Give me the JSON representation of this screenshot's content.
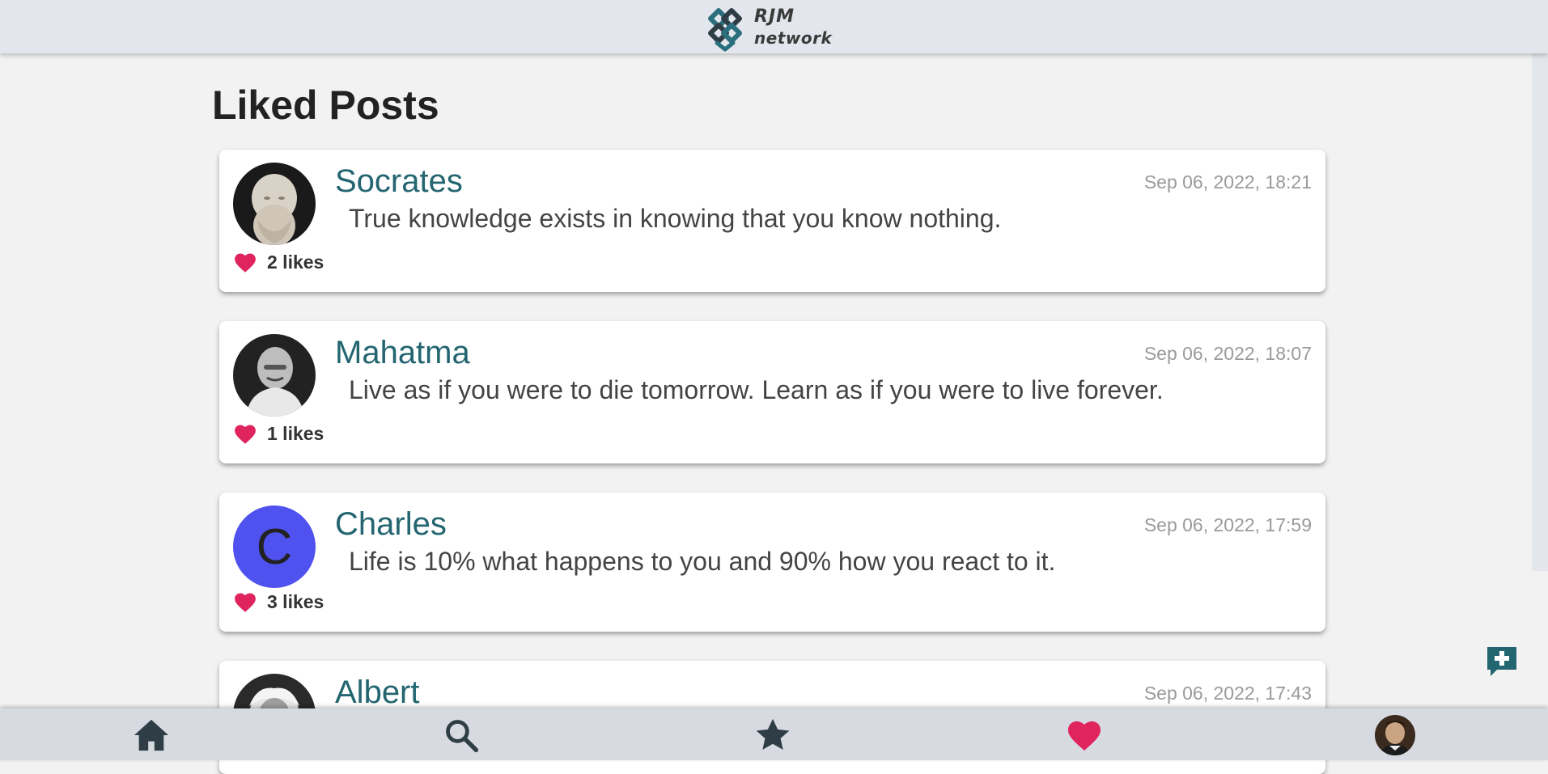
{
  "header": {
    "logo_line1": "RJM",
    "logo_line2": "network"
  },
  "page": {
    "title": "Liked Posts"
  },
  "posts": [
    {
      "author": "Socrates",
      "timestamp": "Sep 06, 2022, 18:21",
      "text": "True knowledge exists in knowing that you know nothing.",
      "likes": "2 likes",
      "avatar": "portrait-photo"
    },
    {
      "author": "Mahatma",
      "timestamp": "Sep 06, 2022, 18:07",
      "text": "Live as if you were to die tomorrow. Learn as if you were to live forever.",
      "likes": "1 likes",
      "avatar": "portrait-photo"
    },
    {
      "author": "Charles",
      "timestamp": "Sep 06, 2022, 17:59",
      "text": "Life is 10% what happens to you and 90% how you react to it.",
      "likes": "3 likes",
      "avatar_letter": "C",
      "avatar_color": "#4f52ee"
    },
    {
      "author": "Albert",
      "timestamp": "Sep 06, 2022, 17:43",
      "avatar": "portrait-photo"
    }
  ],
  "nav": {
    "items": [
      {
        "name": "home",
        "icon": "home-icon",
        "active": false
      },
      {
        "name": "search",
        "icon": "search-icon",
        "active": false
      },
      {
        "name": "starred",
        "icon": "star-icon",
        "active": false
      },
      {
        "name": "liked",
        "icon": "heart-icon",
        "active": true
      },
      {
        "name": "profile",
        "icon": "avatar",
        "active": false
      }
    ]
  },
  "colors": {
    "accent": "#236570",
    "heart": "#e0245e",
    "header_bg": "#e3e6ec",
    "nav_bg": "#d7dbe1",
    "icon_dark": "#2f3e46"
  }
}
